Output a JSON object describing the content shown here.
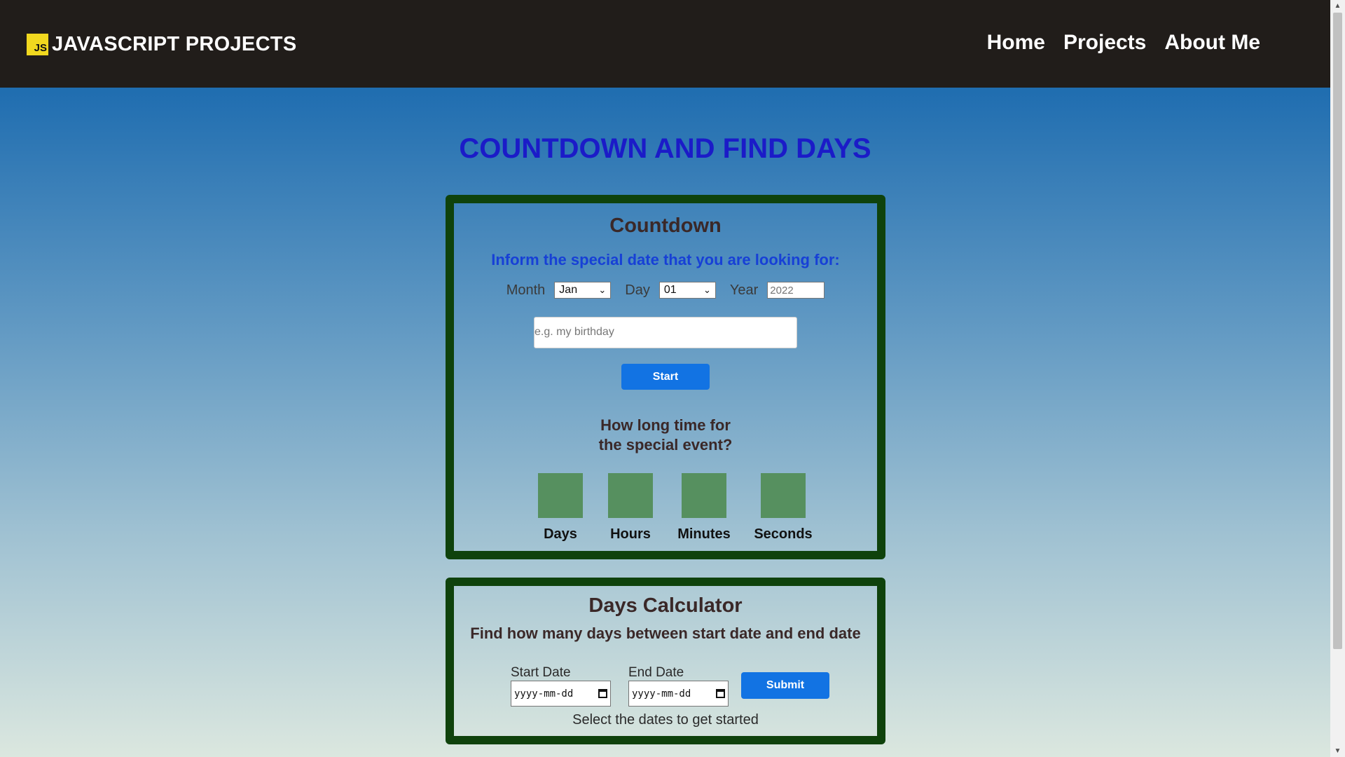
{
  "header": {
    "logo_badge": "JS",
    "logo_text": "JAVASCRIPT PROJECTS",
    "nav": [
      "Home",
      "Projects",
      "About Me"
    ]
  },
  "page": {
    "title": "COUNTDOWN AND FIND DAYS"
  },
  "countdown": {
    "heading": "Countdown",
    "inform": "Inform the special date that you are looking for:",
    "month_label": "Month",
    "month_value": "Jan",
    "day_label": "Day",
    "day_value": "01",
    "year_label": "Year",
    "year_placeholder": "2022",
    "event_placeholder": "e.g. my birthday",
    "start_button": "Start",
    "how_long_line1": "How long time for",
    "how_long_line2": "the special event?",
    "units": [
      "Days",
      "Hours",
      "Minutes",
      "Seconds"
    ]
  },
  "days_calculator": {
    "heading": "Days Calculator",
    "subtitle": "Find how many days between start date and end date",
    "start_label": "Start Date",
    "end_label": "End Date",
    "date_placeholder": "yyyy-mm-dd",
    "submit_button": "Submit",
    "status": "Select the dates to get started"
  },
  "colors": {
    "header_bg": "#211d1a",
    "title": "#1b1bc8",
    "card_border": "#0f420c",
    "button": "#1273e3",
    "unit_box": "#56905f",
    "inform_text": "#1740d6"
  }
}
